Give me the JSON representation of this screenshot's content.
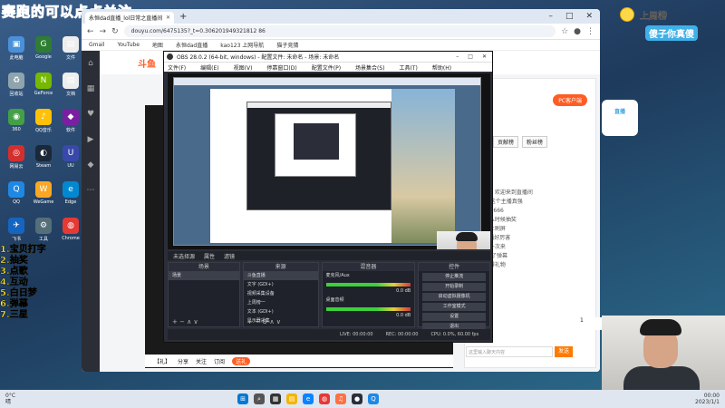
{
  "overlay": {
    "stream_title": "赛跑的可以点点关注",
    "side_list": [
      "1.宝贝打字",
      "2.抽奖",
      "3.点歌",
      "4.互动",
      "5.白日梦",
      "6.弹幕",
      "7.三星"
    ],
    "top_rank": "上周榜",
    "top_rank_sub": "傻子你真傻",
    "right_banner": "直播",
    "mic_label": "1"
  },
  "desktop_icons": [
    {
      "name": "此电脑",
      "color": "#4a90d9",
      "glyph": "▣"
    },
    {
      "name": "Google",
      "color": "#2e7d32",
      "glyph": "G"
    },
    {
      "name": "文件",
      "color": "#eeeeee",
      "glyph": "▤"
    },
    {
      "name": "回收站",
      "color": "#90a4ae",
      "glyph": "♻"
    },
    {
      "name": "GeForce",
      "color": "#76b900",
      "glyph": "N"
    },
    {
      "name": "文档",
      "color": "#eeeeee",
      "glyph": "▤"
    },
    {
      "name": "360",
      "color": "#43a047",
      "glyph": "◉"
    },
    {
      "name": "QQ音乐",
      "color": "#ffc107",
      "glyph": "♪"
    },
    {
      "name": "软件",
      "color": "#7b1fa2",
      "glyph": "◆"
    },
    {
      "name": "网易云",
      "color": "#d32f2f",
      "glyph": "◎"
    },
    {
      "name": "Steam",
      "color": "#1b2838",
      "glyph": "◐"
    },
    {
      "name": "UU",
      "color": "#3949ab",
      "glyph": "U"
    },
    {
      "name": "QQ",
      "color": "#1e88e5",
      "glyph": "Q"
    },
    {
      "name": "WeGame",
      "color": "#f9a825",
      "glyph": "W"
    },
    {
      "name": "Edge",
      "color": "#0288d1",
      "glyph": "e"
    },
    {
      "name": "飞书",
      "color": "#1565c0",
      "glyph": "✈"
    },
    {
      "name": "工具",
      "color": "#546e7a",
      "glyph": "⚙"
    },
    {
      "name": "Chrome",
      "color": "#e53935",
      "glyph": "◍"
    }
  ],
  "browser": {
    "tab_title": "永恒dad直播_lol日常之直播间",
    "url": "douyu.com/6475135?_t=0.306201949321812 86",
    "bookmarks": [
      "Gmail",
      "YouTube",
      "地图",
      "永恒dad直播",
      "kao123 上网导航",
      "猫子竞猜"
    ],
    "site_logo": "斗鱼",
    "pc_button": "PC客户端",
    "rank_tabs": [
      "周榜",
      "贡献榜",
      "粉丝榜"
    ],
    "chat_lines": [
      "系统提示: 欢迎来到直播间",
      "ua5a5: 这个主播真强",
      "aaa: 666666",
      "小鱼: 什么时候抽奖",
      "系统: 禁止刷屏",
      "bob: 主播好厉害",
      "新人: 第一次来",
      "已经开启了弹幕",
      "恭喜: 获得礼物"
    ],
    "chat_placeholder": "这里输入聊天内容",
    "send_label": "发送",
    "bottom_items": [
      "【礼】",
      "分享",
      "关注",
      "订阅"
    ],
    "bottom_btn": "送礼"
  },
  "obs": {
    "title": "OBS 28.0.2 (64-bit, windows) - 配置文件: 未命名 - 场景: 未命名",
    "menu": [
      "文件(F)",
      "编辑(E)",
      "视图(V)",
      "停靠窗口(D)",
      "配置文件(P)",
      "场景集合(S)",
      "工具(T)",
      "帮助(H)"
    ],
    "toolbar": [
      "未选择源",
      "属性",
      "滤镜"
    ],
    "docks": {
      "scenes_title": "场景",
      "scenes": [
        "场景"
      ],
      "sources_title": "来源",
      "sources": [
        "斗鱼直播",
        "文字 (GDI+)",
        "视频采集设备",
        "上周榜一",
        "文本 (GDI+)",
        "显示器采集"
      ],
      "mixer_title": "混音器",
      "mixer": [
        {
          "name": "麦克风/Aux",
          "db": "0.0 dB"
        },
        {
          "name": "桌面音频",
          "db": "0.0 dB"
        }
      ],
      "transitions_title": "转场",
      "controls_title": "控件",
      "controls": [
        "停止推流",
        "开始录制",
        "启动虚拟摄像机",
        "工作室模式",
        "设置",
        "退出"
      ]
    },
    "status": [
      "LIVE: 00:00:00",
      "REC: 00:00:00",
      "CPU: 0.0%, 60.00 fps"
    ]
  },
  "taskbar": {
    "weather_temp": "0°C",
    "weather_desc": "晴",
    "apps": [
      {
        "color": "#0078d4",
        "glyph": "⊞"
      },
      {
        "color": "#555555",
        "glyph": "⌕"
      },
      {
        "color": "#333333",
        "glyph": "▦"
      },
      {
        "color": "#f4b400",
        "glyph": "▤"
      },
      {
        "color": "#0a84ff",
        "glyph": "e"
      },
      {
        "color": "#e53935",
        "glyph": "◍"
      },
      {
        "color": "#ff7043",
        "glyph": "♫"
      },
      {
        "color": "#2b2e38",
        "glyph": "●"
      },
      {
        "color": "#1e88e5",
        "glyph": "Q"
      }
    ],
    "time": "00:00",
    "date": "2023/1/1"
  }
}
